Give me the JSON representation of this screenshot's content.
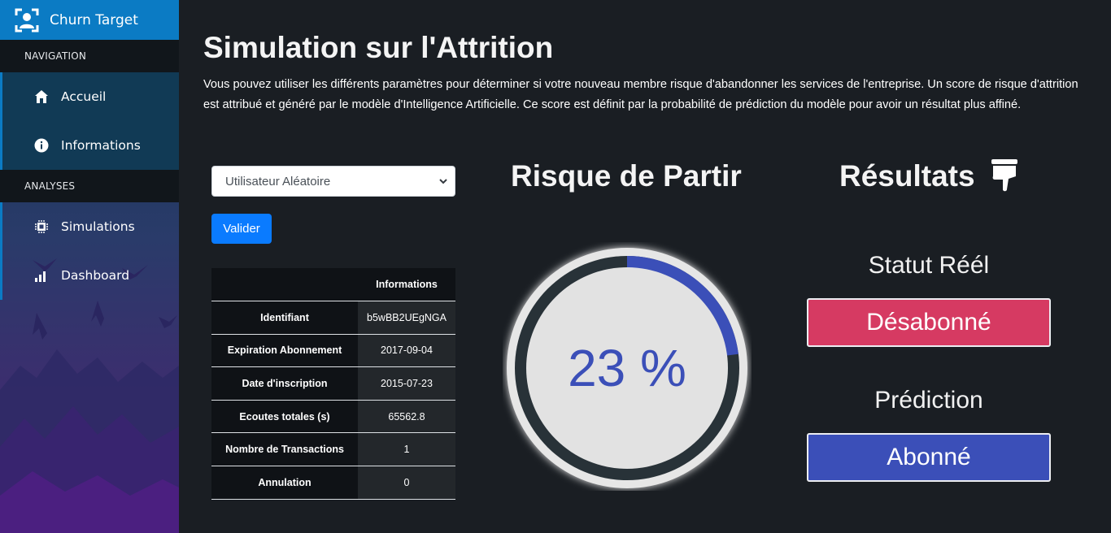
{
  "sidebar": {
    "brand": "Churn Target",
    "brand_icon": "user-focus-icon",
    "sections": [
      {
        "label": "NAVIGATION",
        "items": [
          {
            "label": "Accueil",
            "icon": "home-icon"
          },
          {
            "label": "Informations",
            "icon": "info-icon"
          }
        ]
      },
      {
        "label": "ANALYSES",
        "items": [
          {
            "label": "Simulations",
            "icon": "chip-icon"
          },
          {
            "label": "Dashboard",
            "icon": "bar-chart-icon"
          }
        ]
      }
    ]
  },
  "main": {
    "title": "Simulation sur l'Attrition",
    "description": "Vous pouvez utiliser les différents paramètres pour déterminer si votre nouveau membre risque d'abandonner les services de l'entreprise. Un score de risque d'attrition est attribué et généré par le modèle d'Intelligence Artificielle. Ce score est définit par la probabilité de prédiction du modèle pour avoir un résultat plus affiné.",
    "select_value": "Utilisateur Aléatoire",
    "submit_label": "Valider",
    "table": {
      "header": "Informations",
      "rows": [
        {
          "key": "Identifiant",
          "value": "b5wBB2UEgNGA"
        },
        {
          "key": "Expiration Abonnement",
          "value": "2017-09-04"
        },
        {
          "key": "Date d'inscription",
          "value": "2015-07-23"
        },
        {
          "key": "Ecoutes totales (s)",
          "value": "65562.8"
        },
        {
          "key": "Nombre de Transactions",
          "value": "1"
        },
        {
          "key": "Annulation",
          "value": "0"
        }
      ]
    },
    "risk": {
      "title": "Risque de Partir",
      "percent": 23,
      "label": "23 %",
      "color": "#3b4fb8"
    },
    "results": {
      "title": "Résultats",
      "icon": "thumbs-down-icon",
      "statut_label": "Statut Réél",
      "statut_value": "Désabonné",
      "statut_color": "#d63a62",
      "prediction_label": "Prédiction",
      "prediction_value": "Abonné",
      "prediction_color": "#3b4fb8"
    }
  }
}
